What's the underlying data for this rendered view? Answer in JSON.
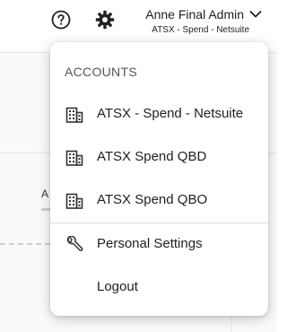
{
  "header": {
    "help_icon": "question-circle-icon",
    "settings_icon": "gear-icon",
    "user": {
      "name": "Anne Final Admin",
      "subtitle": "ATSX - Spend - Netsuite",
      "chevron_icon": "chevron-down-icon"
    }
  },
  "background": {
    "partial_label": "A"
  },
  "menu": {
    "section_title": "ACCOUNTS",
    "accounts": [
      {
        "label": "ATSX - Spend - Netsuite",
        "icon": "building-icon"
      },
      {
        "label": "ATSX Spend QBD",
        "icon": "building-icon"
      },
      {
        "label": "ATSX Spend QBO",
        "icon": "building-icon"
      }
    ],
    "settings": {
      "label": "Personal Settings",
      "icon": "wrench-icon"
    },
    "logout": {
      "label": "Logout"
    }
  }
}
